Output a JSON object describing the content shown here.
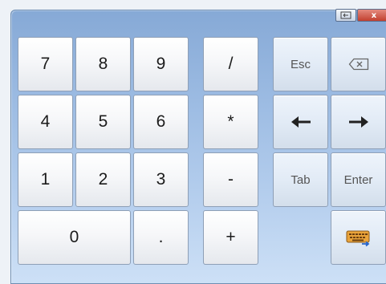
{
  "titlebar": {
    "swap_icon": "swap-keyboard-icon",
    "close_label": "x"
  },
  "numpad": {
    "k7": "7",
    "k8": "8",
    "k9": "9",
    "k4": "4",
    "k5": "5",
    "k6": "6",
    "k1": "1",
    "k2": "2",
    "k3": "3",
    "k0": "0",
    "dot": "."
  },
  "operators": {
    "divide": "/",
    "multiply": "*",
    "minus": "-",
    "plus": "+"
  },
  "special": {
    "esc": "Esc",
    "backspace_icon": "backspace-icon",
    "left_icon": "left-arrow-icon",
    "right_icon": "right-arrow-icon",
    "tab": "Tab",
    "enter": "Enter",
    "keyboard_icon": "keyboard-icon"
  }
}
